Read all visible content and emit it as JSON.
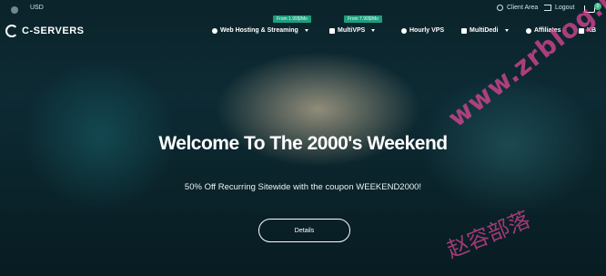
{
  "topbar": {
    "currency": "USD",
    "client_area": "Client Area",
    "logout": "Logout",
    "cart_count": "0"
  },
  "brand": {
    "name": "C-SERVERS"
  },
  "nav": {
    "items": [
      {
        "label": "Web Hosting & Streaming",
        "icon": "server-icon",
        "dropdown": true
      },
      {
        "label": "MultiVPS",
        "icon": "monitor-icon",
        "dropdown": true
      },
      {
        "label": "Hourly VPS",
        "icon": "clock-icon",
        "dropdown": false
      },
      {
        "label": "MultiDedi",
        "icon": "server-icon",
        "dropdown": true
      },
      {
        "label": "Affiliates",
        "icon": "eye-icon",
        "dropdown": false
      },
      {
        "label": "KB",
        "icon": "book-icon",
        "dropdown": false
      }
    ],
    "promos": [
      "From 1.99$/Mo",
      "From 7.99$/Mo"
    ]
  },
  "hero": {
    "title": "Welcome To The 2000's Weekend",
    "subtitle": "50% Off Recurring Sitewide with the coupon WEEKEND2000!",
    "button": "Details"
  },
  "watermark": {
    "line1": "www.zrblog.net",
    "line2": "赵容部落"
  },
  "colors": {
    "accent": "#1f9e7e",
    "badge": "#44b98a",
    "watermark": "#e146a0"
  }
}
